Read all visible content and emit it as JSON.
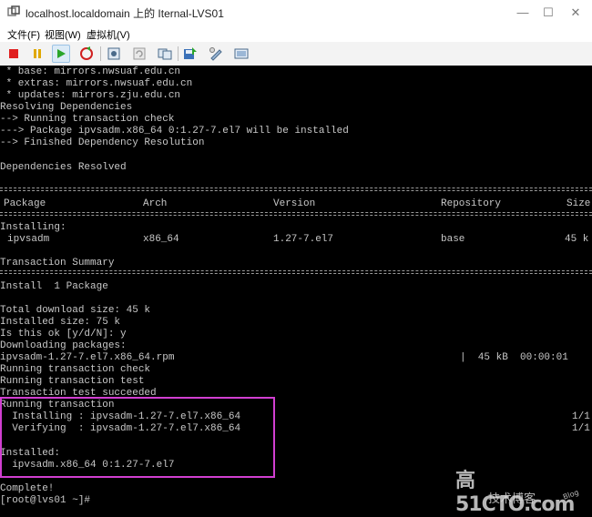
{
  "window": {
    "title": "localhost.localdomain 上的 Iternal-LVS01",
    "minimize_glyph": "—",
    "maximize_glyph": "☐",
    "close_glyph": "✕"
  },
  "menu": {
    "file": "文件(F)",
    "view": "视图(W)",
    "vm": "虚拟机(V)"
  },
  "toolbar": {
    "icons": [
      "stop-icon",
      "pause-icon",
      "play-icon",
      "reset-icon",
      "snapshot-icon",
      "revert-snapshot-icon",
      "manage-snapshots-icon",
      "save-icon",
      "settings-icon",
      "fullscreen-icon"
    ]
  },
  "terminal": {
    "lines": {
      "l01": " * base: mirrors.nwsuaf.edu.cn",
      "l02": " * extras: mirrors.nwsuaf.edu.cn",
      "l03": " * updates: mirrors.zju.edu.cn",
      "l04": "Resolving Dependencies",
      "l05": "--> Running transaction check",
      "l06": "---> Package ipvsadm.x86_64 0:1.27-7.el7 will be installed",
      "l07": "--> Finished Dependency Resolution",
      "l08": "Dependencies Resolved",
      "l09": "Installing:",
      "l10": "Transaction Summary",
      "l11": "Install  1 Package",
      "l12": "Total download size: 45 k",
      "l13": "Installed size: 75 k",
      "l14": "Is this ok [y/d/N]: y",
      "l15": "Downloading packages:",
      "l16": "ipvsadm-1.27-7.el7.x86_64.rpm",
      "l16b": "|  45 kB  00:00:01",
      "l17": "Running transaction check",
      "l18": "Running transaction test",
      "l19": "Transaction test succeeded",
      "l20": "Running transaction",
      "l21": "  Installing : ipvsadm-1.27-7.el7.x86_64",
      "l21b": "1/1",
      "l22": "  Verifying  : ipvsadm-1.27-7.el7.x86_64",
      "l22b": "1/1",
      "l23": "Installed:",
      "l24": "  ipvsadm.x86_64 0:1.27-7.el7",
      "l25": "Complete!",
      "l26": "[root@lvs01 ~]#"
    },
    "table": {
      "headers": [
        "Package",
        "Arch",
        "Version",
        "Repository",
        "Size"
      ],
      "row": [
        "ipvsadm",
        "x86_64",
        "1.27-7.el7",
        "base",
        "45 k"
      ]
    }
  },
  "watermark": {
    "main": "高51CTO.com",
    "sub": "技术博客",
    "blog": "Blog"
  },
  "colors": {
    "terminal_bg": "#000000",
    "terminal_fg": "#c8c8c8",
    "highlight": "#d13fd1"
  }
}
